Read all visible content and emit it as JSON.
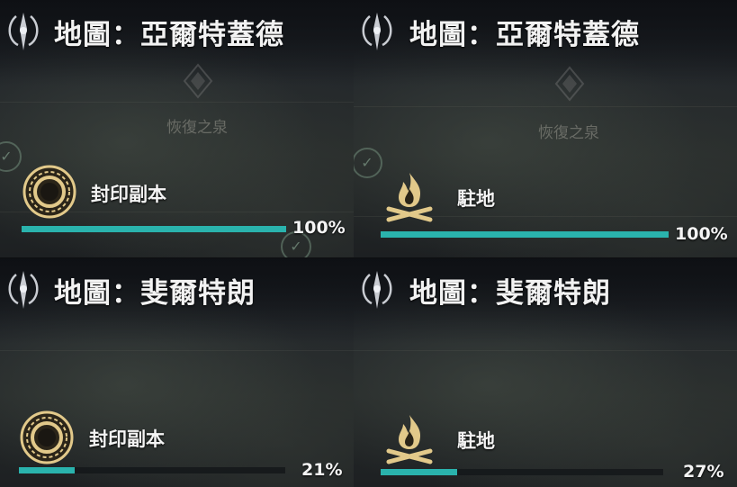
{
  "panels": [
    {
      "map_title": "地圖：亞爾特蓋德",
      "map_label": "恢復之泉",
      "activity_label": "封印副本",
      "activity_icon": "seal-ring-icon",
      "progress": 1.0,
      "progress_text": "100%"
    },
    {
      "map_title": "地圖：亞爾特蓋德",
      "map_label": "恢復之泉",
      "activity_label": "駐地",
      "activity_icon": "campfire-icon",
      "progress": 1.0,
      "progress_text": "100%"
    },
    {
      "map_title": "地圖：斐爾特朗",
      "activity_label": "封印副本",
      "activity_icon": "seal-ring-icon",
      "progress": 0.21,
      "progress_text": "21%"
    },
    {
      "map_title": "地圖：斐爾特朗",
      "activity_label": "駐地",
      "activity_icon": "campfire-icon",
      "progress": 0.27,
      "progress_text": "27%"
    }
  ],
  "colors": {
    "progress_fill": "#2ab3ad",
    "icon_gold": "#e2c98a"
  }
}
